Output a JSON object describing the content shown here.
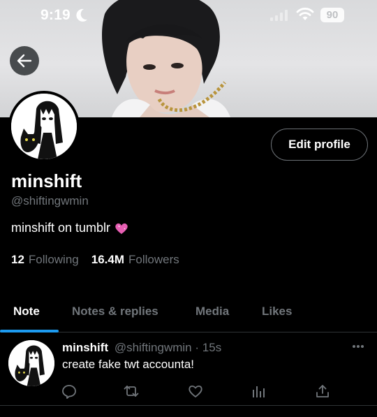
{
  "status_bar": {
    "time": "9:19",
    "battery": "90",
    "icons": [
      "moon-icon",
      "signal-icon",
      "wifi-icon",
      "battery-icon"
    ]
  },
  "header": {
    "back_icon": "back-arrow-icon"
  },
  "profile": {
    "display_name": "minshift",
    "handle": "@shiftingwmin",
    "bio": "minshift on tumblr",
    "bio_emoji": "💗",
    "following_count": "12",
    "following_label": "Following",
    "followers_count": "16.4M",
    "followers_label": "Followers",
    "edit_button": "Edit profile"
  },
  "tabs": [
    {
      "label": "Note",
      "active": true
    },
    {
      "label": "Notes & replies",
      "active": false
    },
    {
      "label": "Media",
      "active": false
    },
    {
      "label": "Likes",
      "active": false
    }
  ],
  "tweet": {
    "name": "minshift",
    "handle": "@shiftingwmin",
    "separator": "·",
    "time": "15s",
    "text": "create fake twt accounta!",
    "actions": [
      "reply-icon",
      "retweet-icon",
      "like-icon",
      "views-icon",
      "share-icon"
    ]
  },
  "colors": {
    "background": "#000000",
    "text_primary": "#e7e9ea",
    "text_secondary": "#71767b",
    "accent": "#1d9bf0",
    "divider": "#2f3336",
    "heart": "#e75fb3"
  }
}
